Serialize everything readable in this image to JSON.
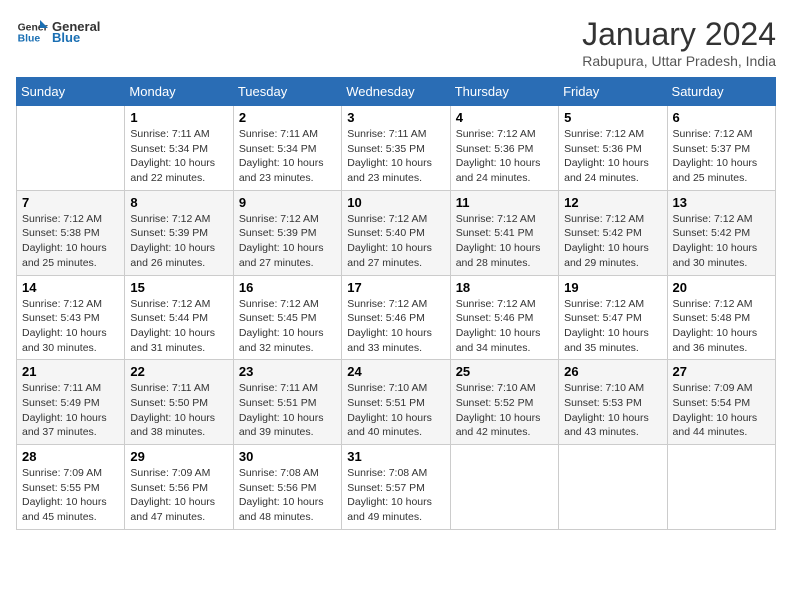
{
  "header": {
    "logo_general": "General",
    "logo_blue": "Blue",
    "month_title": "January 2024",
    "location": "Rabupura, Uttar Pradesh, India"
  },
  "days_of_week": [
    "Sunday",
    "Monday",
    "Tuesday",
    "Wednesday",
    "Thursday",
    "Friday",
    "Saturday"
  ],
  "weeks": [
    [
      {
        "day": "",
        "info": ""
      },
      {
        "day": "1",
        "info": "Sunrise: 7:11 AM\nSunset: 5:34 PM\nDaylight: 10 hours\nand 22 minutes."
      },
      {
        "day": "2",
        "info": "Sunrise: 7:11 AM\nSunset: 5:34 PM\nDaylight: 10 hours\nand 23 minutes."
      },
      {
        "day": "3",
        "info": "Sunrise: 7:11 AM\nSunset: 5:35 PM\nDaylight: 10 hours\nand 23 minutes."
      },
      {
        "day": "4",
        "info": "Sunrise: 7:12 AM\nSunset: 5:36 PM\nDaylight: 10 hours\nand 24 minutes."
      },
      {
        "day": "5",
        "info": "Sunrise: 7:12 AM\nSunset: 5:36 PM\nDaylight: 10 hours\nand 24 minutes."
      },
      {
        "day": "6",
        "info": "Sunrise: 7:12 AM\nSunset: 5:37 PM\nDaylight: 10 hours\nand 25 minutes."
      }
    ],
    [
      {
        "day": "7",
        "info": "Sunrise: 7:12 AM\nSunset: 5:38 PM\nDaylight: 10 hours\nand 25 minutes."
      },
      {
        "day": "8",
        "info": "Sunrise: 7:12 AM\nSunset: 5:39 PM\nDaylight: 10 hours\nand 26 minutes."
      },
      {
        "day": "9",
        "info": "Sunrise: 7:12 AM\nSunset: 5:39 PM\nDaylight: 10 hours\nand 27 minutes."
      },
      {
        "day": "10",
        "info": "Sunrise: 7:12 AM\nSunset: 5:40 PM\nDaylight: 10 hours\nand 27 minutes."
      },
      {
        "day": "11",
        "info": "Sunrise: 7:12 AM\nSunset: 5:41 PM\nDaylight: 10 hours\nand 28 minutes."
      },
      {
        "day": "12",
        "info": "Sunrise: 7:12 AM\nSunset: 5:42 PM\nDaylight: 10 hours\nand 29 minutes."
      },
      {
        "day": "13",
        "info": "Sunrise: 7:12 AM\nSunset: 5:42 PM\nDaylight: 10 hours\nand 30 minutes."
      }
    ],
    [
      {
        "day": "14",
        "info": "Sunrise: 7:12 AM\nSunset: 5:43 PM\nDaylight: 10 hours\nand 30 minutes."
      },
      {
        "day": "15",
        "info": "Sunrise: 7:12 AM\nSunset: 5:44 PM\nDaylight: 10 hours\nand 31 minutes."
      },
      {
        "day": "16",
        "info": "Sunrise: 7:12 AM\nSunset: 5:45 PM\nDaylight: 10 hours\nand 32 minutes."
      },
      {
        "day": "17",
        "info": "Sunrise: 7:12 AM\nSunset: 5:46 PM\nDaylight: 10 hours\nand 33 minutes."
      },
      {
        "day": "18",
        "info": "Sunrise: 7:12 AM\nSunset: 5:46 PM\nDaylight: 10 hours\nand 34 minutes."
      },
      {
        "day": "19",
        "info": "Sunrise: 7:12 AM\nSunset: 5:47 PM\nDaylight: 10 hours\nand 35 minutes."
      },
      {
        "day": "20",
        "info": "Sunrise: 7:12 AM\nSunset: 5:48 PM\nDaylight: 10 hours\nand 36 minutes."
      }
    ],
    [
      {
        "day": "21",
        "info": "Sunrise: 7:11 AM\nSunset: 5:49 PM\nDaylight: 10 hours\nand 37 minutes."
      },
      {
        "day": "22",
        "info": "Sunrise: 7:11 AM\nSunset: 5:50 PM\nDaylight: 10 hours\nand 38 minutes."
      },
      {
        "day": "23",
        "info": "Sunrise: 7:11 AM\nSunset: 5:51 PM\nDaylight: 10 hours\nand 39 minutes."
      },
      {
        "day": "24",
        "info": "Sunrise: 7:10 AM\nSunset: 5:51 PM\nDaylight: 10 hours\nand 40 minutes."
      },
      {
        "day": "25",
        "info": "Sunrise: 7:10 AM\nSunset: 5:52 PM\nDaylight: 10 hours\nand 42 minutes."
      },
      {
        "day": "26",
        "info": "Sunrise: 7:10 AM\nSunset: 5:53 PM\nDaylight: 10 hours\nand 43 minutes."
      },
      {
        "day": "27",
        "info": "Sunrise: 7:09 AM\nSunset: 5:54 PM\nDaylight: 10 hours\nand 44 minutes."
      }
    ],
    [
      {
        "day": "28",
        "info": "Sunrise: 7:09 AM\nSunset: 5:55 PM\nDaylight: 10 hours\nand 45 minutes."
      },
      {
        "day": "29",
        "info": "Sunrise: 7:09 AM\nSunset: 5:56 PM\nDaylight: 10 hours\nand 47 minutes."
      },
      {
        "day": "30",
        "info": "Sunrise: 7:08 AM\nSunset: 5:56 PM\nDaylight: 10 hours\nand 48 minutes."
      },
      {
        "day": "31",
        "info": "Sunrise: 7:08 AM\nSunset: 5:57 PM\nDaylight: 10 hours\nand 49 minutes."
      },
      {
        "day": "",
        "info": ""
      },
      {
        "day": "",
        "info": ""
      },
      {
        "day": "",
        "info": ""
      }
    ]
  ]
}
